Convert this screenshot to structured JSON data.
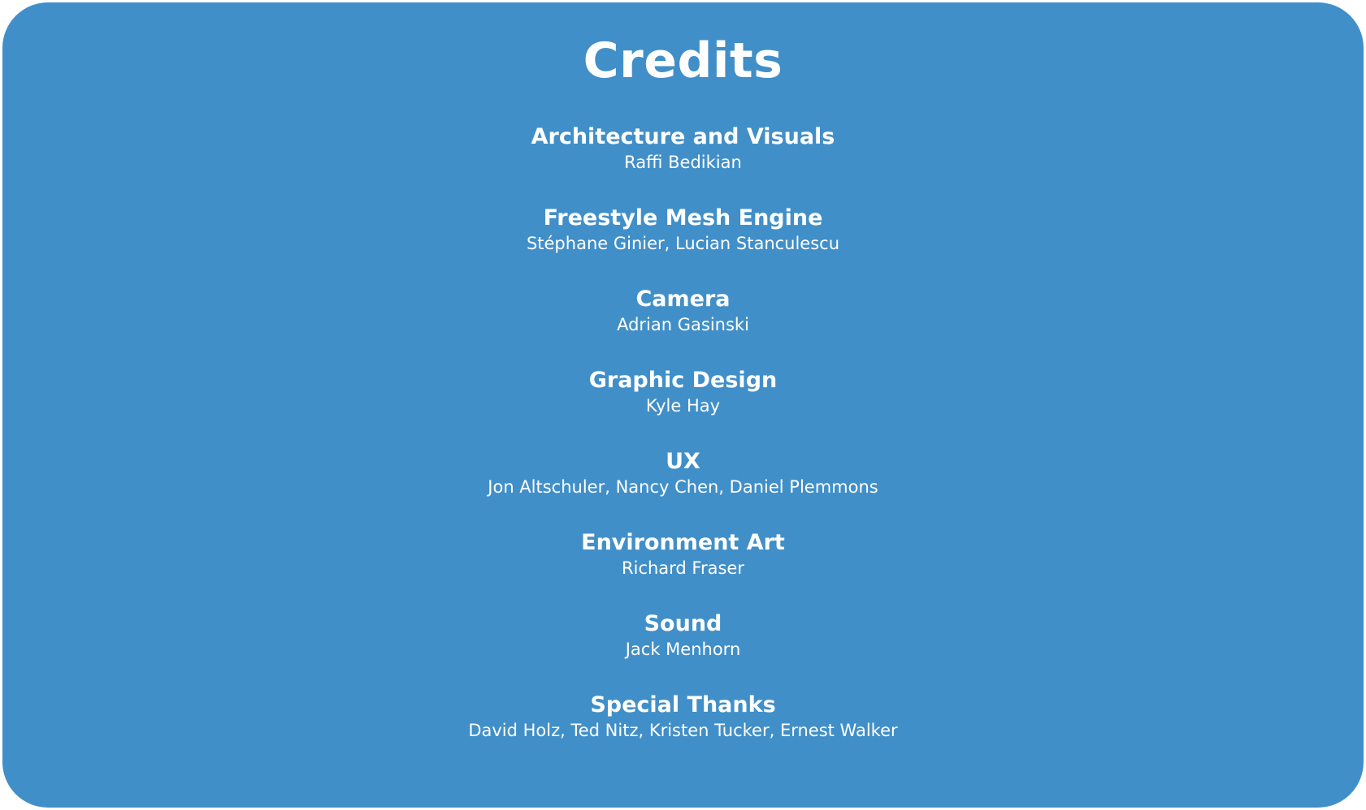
{
  "title": "Credits",
  "colors": {
    "panel_background": "#418fc8",
    "text": "#ffffff",
    "page_background": "#ffffff"
  },
  "sections": [
    {
      "role": "Architecture and Visuals",
      "names": "Raffi Bedikian"
    },
    {
      "role": "Freestyle Mesh Engine",
      "names": "Stéphane Ginier, Lucian Stanculescu"
    },
    {
      "role": "Camera",
      "names": "Adrian Gasinski"
    },
    {
      "role": "Graphic Design",
      "names": "Kyle Hay"
    },
    {
      "role": "UX",
      "names": "Jon Altschuler, Nancy Chen, Daniel Plemmons"
    },
    {
      "role": "Environment Art",
      "names": "Richard Fraser"
    },
    {
      "role": "Sound",
      "names": "Jack Menhorn"
    },
    {
      "role": "Special Thanks",
      "names": "David Holz, Ted Nitz, Kristen Tucker, Ernest Walker"
    }
  ]
}
